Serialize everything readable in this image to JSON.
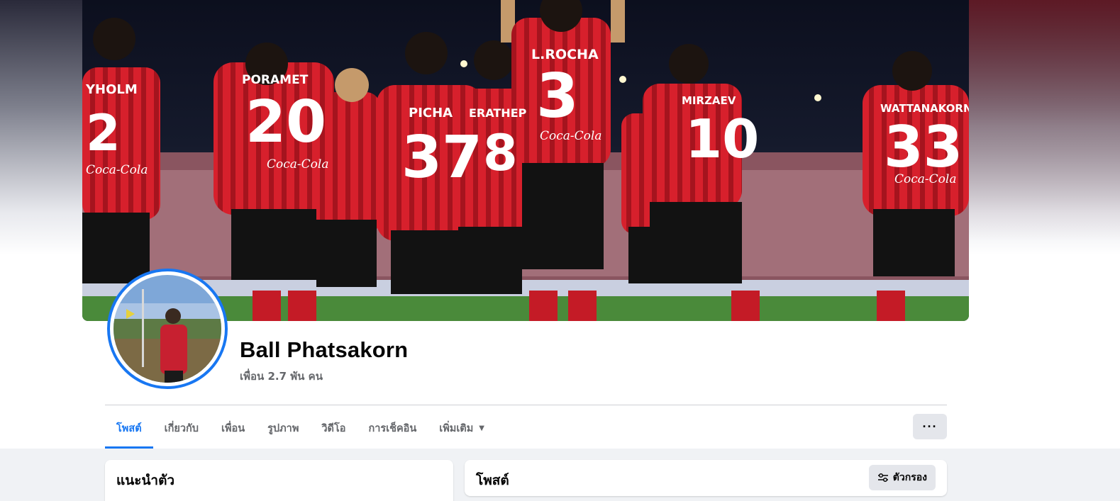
{
  "profile": {
    "name": "Ball Phatsakorn",
    "friends_count": "เพื่อน 2.7 พัน คน"
  },
  "cover": {
    "jersey_names": [
      "YHOLM",
      "PORAMET",
      "PICHA",
      "ERATHEP",
      "L.ROCHA",
      "MIRZAEV",
      "WATTANAKORN"
    ],
    "jersey_numbers": [
      "2",
      "20",
      "37",
      "8",
      "3",
      "10",
      "33"
    ],
    "sponsor": "Coca-Cola"
  },
  "tabs": [
    {
      "label": "โพสต์",
      "active": true
    },
    {
      "label": "เกี่ยวกับ",
      "active": false
    },
    {
      "label": "เพื่อน",
      "active": false
    },
    {
      "label": "รูปภาพ",
      "active": false
    },
    {
      "label": "วิดีโอ",
      "active": false
    },
    {
      "label": "การเช็คอิน",
      "active": false
    },
    {
      "label": "เพิ่มเติม",
      "active": false
    }
  ],
  "more_button": "···",
  "intro": {
    "title": "แนะนำตัว"
  },
  "posts": {
    "title": "โพสต์",
    "filter_label": "ตัวกรอง"
  },
  "colors": {
    "accent": "#1877f2",
    "jersey_red": "#d7202c",
    "page_bg": "#f0f2f5"
  }
}
